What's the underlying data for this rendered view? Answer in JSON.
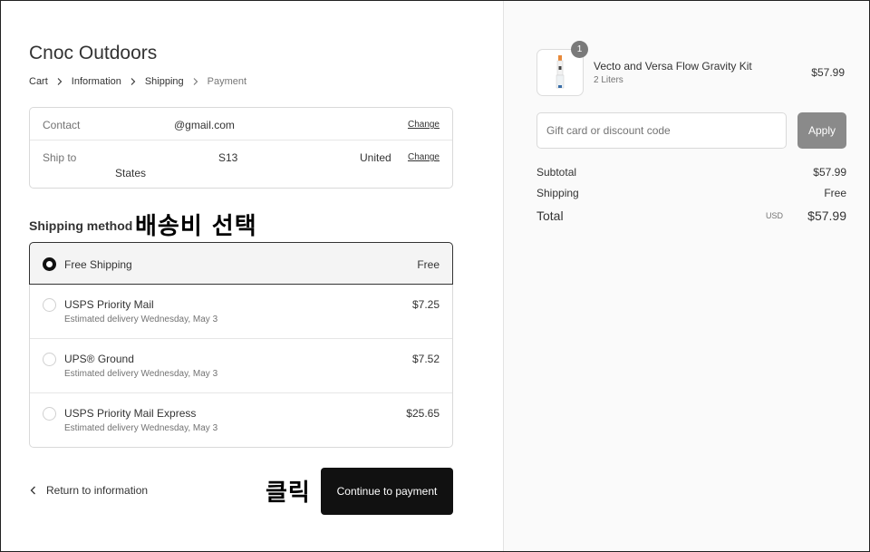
{
  "store": {
    "name": "Cnoc Outdoors"
  },
  "breadcrumb": {
    "cart": "Cart",
    "information": "Information",
    "shipping": "Shipping",
    "payment": "Payment"
  },
  "review": {
    "contact_label": "Contact",
    "contact_value": "@gmail.com",
    "ship_to_label": "Ship to",
    "ship_to_part1": "S13",
    "ship_to_part2": "United",
    "ship_to_part3": "States",
    "change_label": "Change"
  },
  "shipping_method": {
    "title": "Shipping method",
    "annotation": "배송비 선택",
    "options": [
      {
        "name": "Free Shipping",
        "subtitle": "",
        "price": "Free",
        "selected": true
      },
      {
        "name": "USPS Priority Mail",
        "subtitle": "Estimated delivery Wednesday, May 3",
        "price": "$7.25",
        "selected": false
      },
      {
        "name": "UPS® Ground",
        "subtitle": "Estimated delivery Wednesday, May 3",
        "price": "$7.52",
        "selected": false
      },
      {
        "name": "USPS Priority Mail Express",
        "subtitle": "Estimated delivery Wednesday, May 3",
        "price": "$25.65",
        "selected": false
      }
    ]
  },
  "footer": {
    "return_label": "Return to information",
    "continue_label": "Continue to payment",
    "annotation": "클릭"
  },
  "order": {
    "quantity": "1",
    "product_name": "Vecto and Versa Flow Gravity Kit",
    "product_variant": "2 Liters",
    "product_price": "$57.99",
    "discount_placeholder": "Gift card or discount code",
    "apply_label": "Apply",
    "subtotal_label": "Subtotal",
    "subtotal_value": "$57.99",
    "shipping_label": "Shipping",
    "shipping_value": "Free",
    "total_label": "Total",
    "currency": "USD",
    "total_value": "$57.99"
  },
  "colors": {
    "selected_border": "#333333",
    "button_dark": "#111111",
    "apply_button": "#8a8a8a",
    "sidebar_bg": "#fafafa"
  },
  "icons": [
    "chevron-right-icon",
    "chevron-left-icon",
    "radio-icon",
    "product-image"
  ]
}
